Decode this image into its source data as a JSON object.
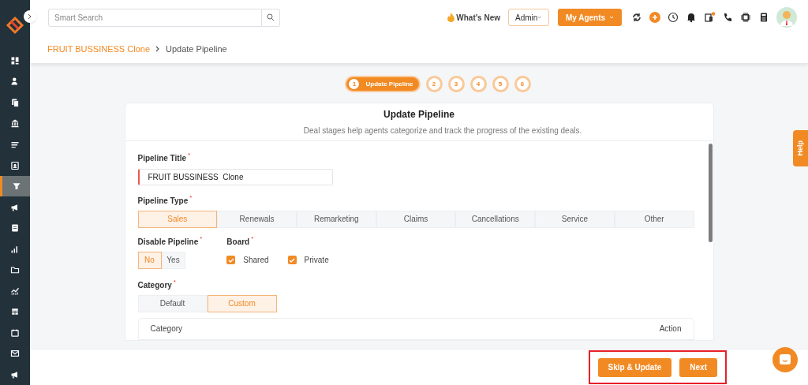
{
  "sidebar": {
    "items": [
      {
        "selected": false
      },
      {
        "selected": false
      },
      {
        "selected": false
      },
      {
        "selected": false
      },
      {
        "selected": false
      },
      {
        "selected": false
      },
      {
        "selected": true
      },
      {
        "selected": false
      },
      {
        "selected": false
      },
      {
        "selected": false
      },
      {
        "selected": false
      },
      {
        "selected": false
      },
      {
        "selected": false
      },
      {
        "selected": false
      },
      {
        "selected": false
      },
      {
        "selected": false
      }
    ]
  },
  "topbar": {
    "search_placeholder": "Smart Search",
    "whats_new": "What's New",
    "role_select": "Admin",
    "agents_button": "My Agents",
    "notification_dot": true
  },
  "breadcrumb": [
    "FRUIT BUSSINESS Clone",
    "Update Pipeline"
  ],
  "stepper": [
    {
      "number": "1",
      "label": "Update Pipeline",
      "selected": true
    },
    {
      "number": "2",
      "selected": false
    },
    {
      "number": "3",
      "selected": false
    },
    {
      "number": "4",
      "selected": false
    },
    {
      "number": "5",
      "selected": false
    },
    {
      "number": "6",
      "selected": false
    }
  ],
  "card": {
    "title": "Update Pipeline",
    "subtitle": "Deal stages help agents categorize and track the progress of the existing deals."
  },
  "form": {
    "pipeline_title": {
      "label": "Pipeline Title",
      "required_mark": "*",
      "value": "FRUIT BUSSINESS  Clone"
    },
    "pipeline_type": {
      "label": "Pipeline Type",
      "required_mark": "*",
      "options": [
        {
          "label": "Sales",
          "selected": true
        },
        {
          "label": "Renewals",
          "selected": false
        },
        {
          "label": "Remarketing",
          "selected": false
        },
        {
          "label": "Claims",
          "selected": false
        },
        {
          "label": "Cancellations",
          "selected": false
        },
        {
          "label": "Service",
          "selected": false
        },
        {
          "label": "Other",
          "selected": false
        }
      ]
    },
    "disable_pipeline": {
      "label": "Disable Pipeline",
      "required_mark": "*",
      "options": [
        {
          "label": "No",
          "selected": true
        },
        {
          "label": "Yes",
          "selected": false
        }
      ]
    },
    "board": {
      "label": "Board",
      "required_mark": "*",
      "options": [
        {
          "label": "Shared",
          "checked": true
        },
        {
          "label": "Private",
          "checked": true
        }
      ]
    },
    "category": {
      "label": "Category",
      "required_mark": "*",
      "options": [
        {
          "label": "Default",
          "selected": false
        },
        {
          "label": "Custom",
          "selected": true
        }
      ]
    },
    "category_table": {
      "columns": [
        "Category",
        "Action"
      ]
    }
  },
  "footer": {
    "buttons": [
      "Skip & Update",
      "Next"
    ]
  },
  "help_tab": "Help"
}
